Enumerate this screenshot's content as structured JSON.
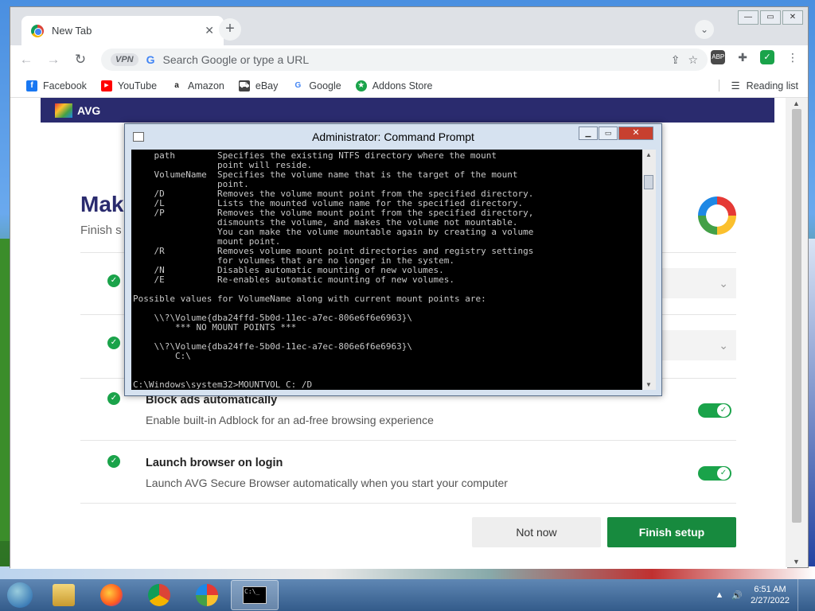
{
  "browser": {
    "tab_title": "New Tab",
    "tab_close": "✕",
    "new_tab": "+",
    "tab_search": "⌄",
    "win_min": "—",
    "win_max": "▭",
    "win_close": "✕",
    "omnibox_placeholder": "Search Google or type a URL",
    "vpn_label": "VPN",
    "bookmarks": [
      {
        "label": "Facebook",
        "icon": "facebook-icon",
        "color": "#1877f2",
        "glyph": "f"
      },
      {
        "label": "YouTube",
        "icon": "youtube-icon",
        "color": "#ff0000",
        "glyph": "▶"
      },
      {
        "label": "Amazon",
        "icon": "amazon-icon",
        "color": "#222222",
        "glyph": "a"
      },
      {
        "label": "eBay",
        "icon": "ebay-icon",
        "color": "#e53238",
        "glyph": "e"
      },
      {
        "label": "Google",
        "icon": "google-icon",
        "color": "#4285f4",
        "glyph": "G"
      },
      {
        "label": "Addons Store",
        "icon": "addons-store-icon",
        "color": "#1aa34a",
        "glyph": "★"
      }
    ],
    "reading_list": "Reading list"
  },
  "page": {
    "brand": "AVG",
    "heading": "Mak",
    "subheading": "Finish s",
    "rows": [
      {
        "title": "Block ads automatically",
        "desc": "Enable built-in Adblock for an ad-free browsing experience",
        "toggle": "on"
      },
      {
        "title": "Launch browser on login",
        "desc": "Launch AVG Secure Browser automatically when you start your computer",
        "toggle": "on"
      }
    ],
    "chevron": "⌄",
    "not_now": "Not now",
    "finish_setup": "Finish setup"
  },
  "cmd": {
    "title": "Administrator: Command Prompt",
    "min": "▁",
    "max": "▭",
    "close": "✕",
    "lines": [
      "    path        Specifies the existing NTFS directory where the mount",
      "                point will reside.",
      "    VolumeName  Specifies the volume name that is the target of the mount",
      "                point.",
      "    /D          Removes the volume mount point from the specified directory.",
      "    /L          Lists the mounted volume name for the specified directory.",
      "    /P          Removes the volume mount point from the specified directory,",
      "                dismounts the volume, and makes the volume not mountable.",
      "                You can make the volume mountable again by creating a volume",
      "                mount point.",
      "    /R          Removes volume mount point directories and registry settings",
      "                for volumes that are no longer in the system.",
      "    /N          Disables automatic mounting of new volumes.",
      "    /E          Re-enables automatic mounting of new volumes.",
      "",
      "Possible values for VolumeName along with current mount points are:",
      "",
      "    \\\\?\\Volume{dba24ffd-5b0d-11ec-a7ec-806e6f6e6963}\\",
      "        *** NO MOUNT POINTS ***",
      "",
      "    \\\\?\\Volume{dba24ffe-5b0d-11ec-a7ec-806e6f6e6963}\\",
      "        C:\\",
      "",
      "",
      "C:\\Windows\\system32>MOUNTVOL C: /D"
    ]
  },
  "taskbar": {
    "time": "6:51 AM",
    "date": "2/27/2022",
    "cmd_label": "C:\\_"
  },
  "colors": {
    "avg_navy": "#2a2b6e",
    "avg_green": "#178a3e",
    "toggle_green": "#1aa34a"
  }
}
